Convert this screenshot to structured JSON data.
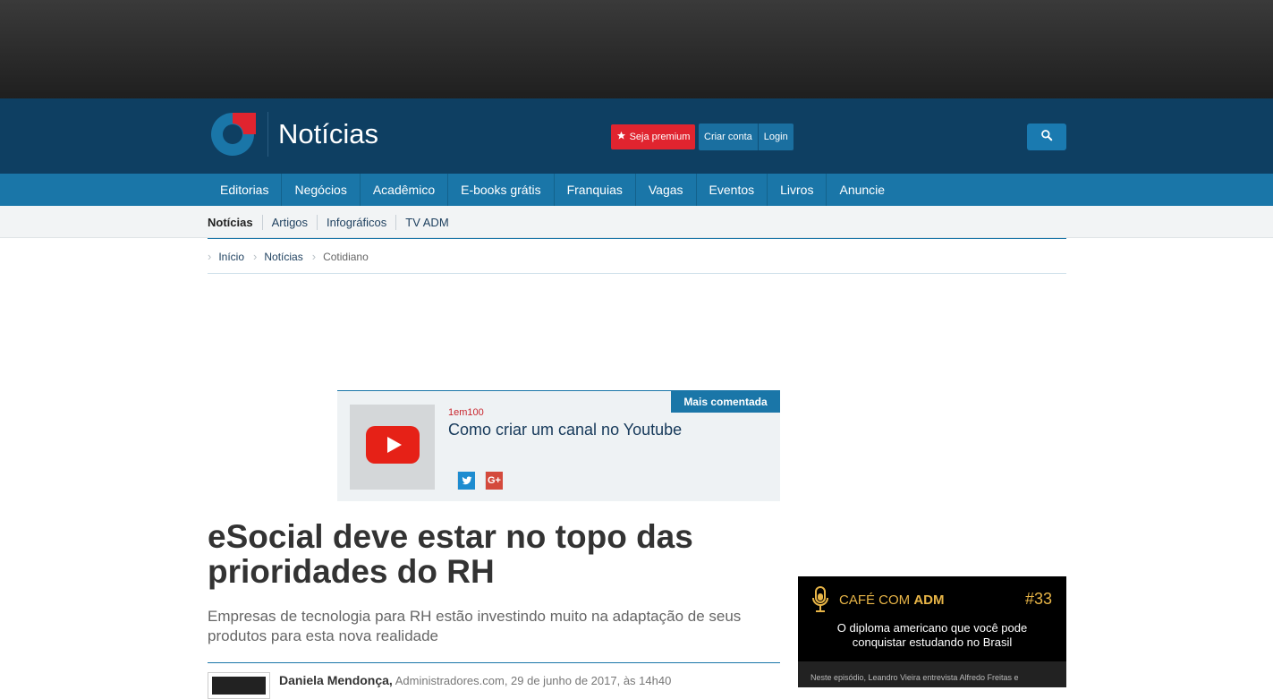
{
  "header": {
    "site_title": "Notícias",
    "premium_label": "Seja premium",
    "create_account_label": "Criar conta",
    "login_label": "Login"
  },
  "main_nav": {
    "items": [
      "Editorias",
      "Negócios",
      "Acadêmico",
      "E-books grátis",
      "Franquias",
      "Vagas",
      "Eventos",
      "Livros",
      "Anuncie"
    ]
  },
  "sub_nav": {
    "items": [
      "Notícias",
      "Artigos",
      "Infográficos",
      "TV ADM"
    ]
  },
  "breadcrumb": {
    "items": [
      "Início",
      "Notícias",
      "Cotidiano"
    ]
  },
  "featured": {
    "tag": "Mais comentada",
    "kicker": "1em100",
    "title": "Como criar um canal no Youtube",
    "share": [
      "twitter",
      "google-plus"
    ],
    "google_plus_glyph": "G+"
  },
  "article": {
    "headline": "eSocial deve estar no topo das prioridades do RH",
    "subheadline": "Empresas de tecnologia para RH estão investindo muito na adaptação de seus produtos para esta nova realidade",
    "author": "Daniela Mendonça,",
    "byline_rest": "Administradores.com, 29 de junho de 2017, às 14h40"
  },
  "podcast": {
    "brand_prefix": "CAFÉ COM ",
    "brand_bold": "ADM",
    "episode": "#33",
    "title": "O diploma americano que você pode conquistar estudando no Brasil",
    "description": "Neste episódio, Leandro Vieira entrevista Alfredo Freitas e"
  },
  "colors": {
    "header_bg": "#0e3f62",
    "nav_bg": "#1a76a8",
    "premium_red": "#e0242f",
    "podcast_gold": "#e8b547"
  }
}
